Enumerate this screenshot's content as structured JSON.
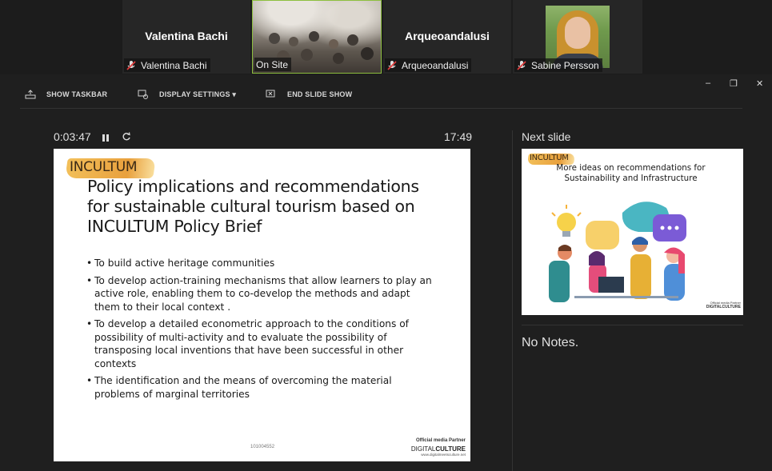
{
  "participants": [
    {
      "display_name": "Valentina Bachi",
      "label": "Valentina Bachi",
      "muted": true,
      "video": false
    },
    {
      "display_name": "",
      "label": "On Site",
      "muted": false,
      "video": true,
      "active": true
    },
    {
      "display_name": "Arqueoandalusi",
      "label": "Arqueoandalusi",
      "muted": true,
      "video": false
    },
    {
      "display_name": "",
      "label": "Sabine Persson",
      "muted": true,
      "video": true
    }
  ],
  "window_controls": {
    "minimize": "–",
    "restore": "❐",
    "close": "✕"
  },
  "toolbar": {
    "show_taskbar": "SHOW TASKBAR",
    "display_settings": "DISPLAY SETTINGS ▾",
    "end_slide_show": "END SLIDE SHOW"
  },
  "presenter": {
    "elapsed": "0:03:47",
    "clock": "17:49",
    "next_slide_label": "Next slide",
    "notes": "No Notes."
  },
  "current_slide": {
    "logo": "INCULTUM",
    "title": "Policy implications and recommendations for sustainable cultural tourism based on INCULTUM Policy Brief",
    "bullets": [
      "To build active heritage communities",
      "To develop action-training mechanisms that allow learners to play an active role, enabling them to co-develop the methods and adapt them to their local context .",
      "To develop a detailed econometric approach to the conditions of possibility of multi-activity and to evaluate the possibility of transposing local inventions that have been successful in other contexts",
      "The identification and the means of overcoming the material problems of marginal territories"
    ],
    "slide_number": "101004552",
    "partner_label": "Official media Partner",
    "partner_brand_a": "DIGITAL",
    "partner_brand_b": "CULTURE",
    "partner_url": "www.digitalmeetsculture.net"
  },
  "next_slide": {
    "logo": "INCULTUM",
    "title": "More ideas on recommendations for Sustainability and Infrastructure",
    "partner_label": "Official media Partner",
    "partner_brand": "DIGITALCULTURE"
  },
  "colors": {
    "active_tile_border": "#8dbf3f",
    "background": "#1f1f1f",
    "logo_brush": "#e8a23a"
  }
}
